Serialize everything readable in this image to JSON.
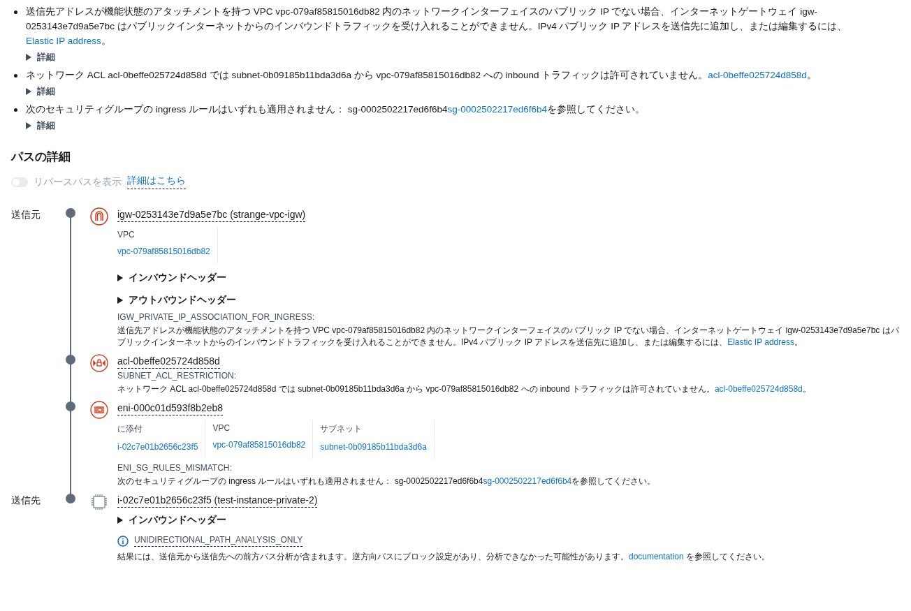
{
  "findings": [
    {
      "text": "送信先アドレスが機能状態のアタッチメントを持つ VPC vpc-079af85815016db82 内のネットワークインターフェイスのパブリック IP でない場合、インターネットゲートウェイ igw-0253143e7d9a5e7bc はパブリックインターネットからのインバウンドトラフィックを受け入れることができません。IPv4 パブリック IP アドレスを送信先に追加し、または編集するには、",
      "link": "Elastic IP address",
      "after": "。",
      "details": {
        "label": "詳細",
        "expanded": false
      }
    },
    {
      "text": "ネットワーク ACL acl-0beffe025724d858d では subnet-0b09185b11bda3d6a から vpc-079af85815016db82 への inbound トラフィックは許可されていません。",
      "link": "acl-0beffe025724d858d",
      "after": "。",
      "details": {
        "label": "詳細",
        "expanded": false
      }
    },
    {
      "text": "次のセキュリティグループの ingress ルールはいずれも適用されません： sg-0002502217ed6f6b4",
      "link": "sg-0002502217ed6f6b4",
      "after": "を参照してください。",
      "details": {
        "label": "詳細",
        "expanded": false
      }
    }
  ],
  "path_details": {
    "title": "パスの詳細",
    "reverse_toggle": {
      "label": "リバースパスを表示",
      "on": false,
      "disabled": true
    },
    "learn_more": "詳細はこちら",
    "steps": [
      {
        "role": "送信元",
        "kind": "gateway",
        "title": "igw-0253143e7d9a5e7bc (strange-vpc-igw)",
        "properties": [
          {
            "label": "VPC",
            "value": "vpc-079af85815016db82"
          }
        ],
        "headers": [
          {
            "label": "インバウンドヘッダー",
            "expanded": false
          },
          {
            "label": "アウトバウンドヘッダー",
            "expanded": false
          }
        ],
        "explanations": [
          {
            "code": "IGW_PRIVATE_IP_ASSOCIATION_FOR_INGRESS:",
            "text": "送信先アドレスが機能状態のアタッチメントを持つ VPC vpc-079af85815016db82 内のネットワークインターフェイスのパブリック IP でない場合、インターネットゲートウェイ igw-0253143e7d9a5e7bc はパブリックインターネットからのインバウンドトラフィックを受け入れることができません。IPv4 パブリック IP アドレスを送信先に追加し、または編集するには、",
            "link": "Elastic IP address",
            "after": "。"
          }
        ]
      },
      {
        "kind": "acl",
        "title": "acl-0beffe025724d858d",
        "explanations": [
          {
            "code": "SUBNET_ACL_RESTRICTION:",
            "text": "ネットワーク ACL acl-0beffe025724d858d では subnet-0b09185b11bda3d6a から vpc-079af85815016db82 への inbound トラフィックは許可されていません。",
            "link": "acl-0beffe025724d858d",
            "after": "。"
          }
        ]
      },
      {
        "kind": "eni",
        "title": "eni-000c01d593f8b2eb8",
        "properties": [
          {
            "label": "に添付",
            "value": "i-02c7e01b2656c23f5"
          },
          {
            "label": "VPC",
            "value": "vpc-079af85815016db82"
          },
          {
            "label": "サブネット",
            "value": "subnet-0b09185b11bda3d6a"
          }
        ],
        "explanations": [
          {
            "code": "ENI_SG_RULES_MISMATCH:",
            "text": "次のセキュリティグループの ingress ルールはいずれも適用されません： sg-0002502217ed6f6b4",
            "link": "sg-0002502217ed6f6b4",
            "after": "を参照してください。"
          }
        ]
      },
      {
        "role": "送信先",
        "kind": "instance",
        "title": "i-02c7e01b2656c23f5 (test-instance-private-2)",
        "headers": [
          {
            "label": "インバウンドヘッダー",
            "expanded": false
          }
        ],
        "notice": {
          "code": "UNIDIRECTIONAL_PATH_ANALYSIS_ONLY",
          "text": "結果には、送信元から送信先への前方パス分析が含まれます。逆方向パスにブロック設定があり、分析できなかった可能性があります。",
          "link": "documentation",
          "after": " を参照してください。"
        }
      }
    ]
  }
}
